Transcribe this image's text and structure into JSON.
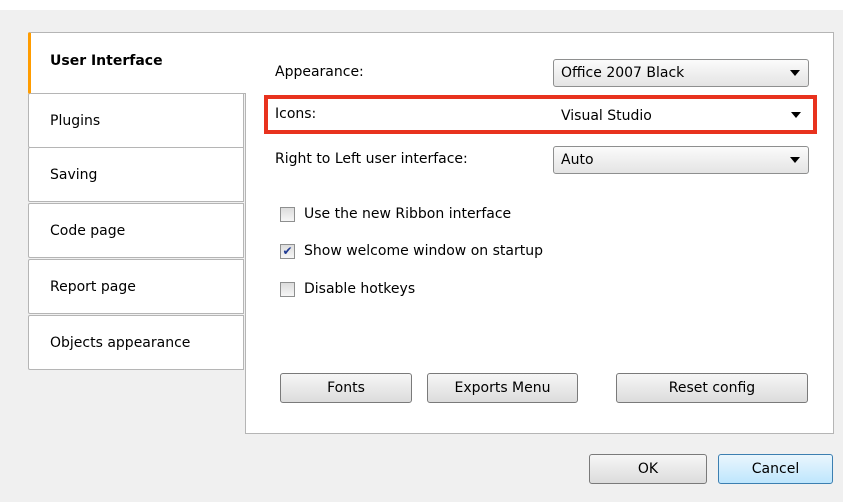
{
  "tabs": [
    {
      "label": "User Interface",
      "active": true
    },
    {
      "label": "Plugins"
    },
    {
      "label": "Saving"
    },
    {
      "label": "Code page"
    },
    {
      "label": "Report page"
    },
    {
      "label": "Objects appearance"
    }
  ],
  "settings": {
    "appearance_label": "Appearance:",
    "appearance_value": "Office 2007 Black",
    "icons_label": "Icons:",
    "icons_value": "Visual Studio",
    "rtl_label": "Right to Left user interface:",
    "rtl_value": "Auto"
  },
  "checkboxes": [
    {
      "label": "Use the new Ribbon interface",
      "checked": false,
      "mark": ""
    },
    {
      "label": "Show welcome window on startup",
      "checked": true,
      "mark": "✔"
    },
    {
      "label": "Disable hotkeys",
      "checked": false,
      "mark": ""
    }
  ],
  "panel_buttons": {
    "fonts": "Fonts",
    "exports_menu": "Exports Menu",
    "reset_config": "Reset config"
  },
  "dialog_buttons": {
    "ok": "OK",
    "cancel": "Cancel"
  },
  "colors": {
    "active_tab_accent": "#ff9c00",
    "highlight_border": "#e8321e",
    "default_button": "#bee6fd"
  }
}
